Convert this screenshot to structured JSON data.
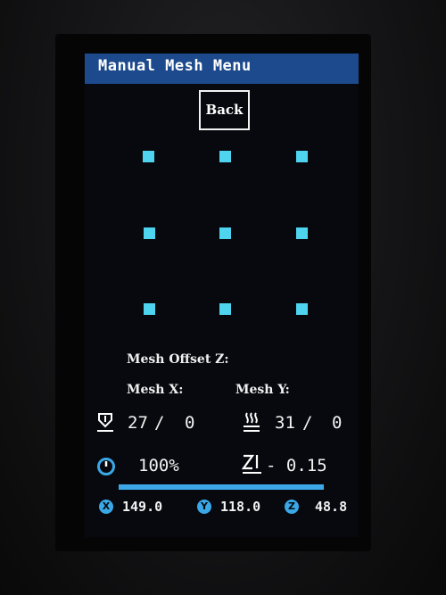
{
  "header": {
    "title": "Manual Mesh Menu"
  },
  "nav": {
    "back_label": "Back"
  },
  "mesh": {
    "rows": 3,
    "columns": 3,
    "point_color": "#4fd4f0",
    "offset_label": "Mesh Offset Z:",
    "x_label": "Mesh X:",
    "y_label": "Mesh Y:"
  },
  "status": {
    "hotend": {
      "icon": "nozzle-icon",
      "current": "27",
      "separator": "/",
      "target": "0"
    },
    "bed": {
      "icon": "heat-bed-icon",
      "current": "31",
      "separator": "/",
      "target": "0"
    },
    "speed": {
      "icon": "speed-gauge-icon",
      "value": "100%"
    },
    "z_offset": {
      "icon": "z-offset-icon",
      "value": "- 0.15"
    },
    "progress": {
      "fraction": 1.0,
      "color": "#3da8e8"
    },
    "position": {
      "x": {
        "label": "X",
        "value": "149.0"
      },
      "y": {
        "label": "Y",
        "value": "118.0"
      },
      "z": {
        "label": "Z",
        "value": "48.8"
      }
    }
  },
  "theme": {
    "title_bar": "#1d4a8c",
    "screen_background": "#07090e",
    "accent": "#3aa8e6"
  }
}
